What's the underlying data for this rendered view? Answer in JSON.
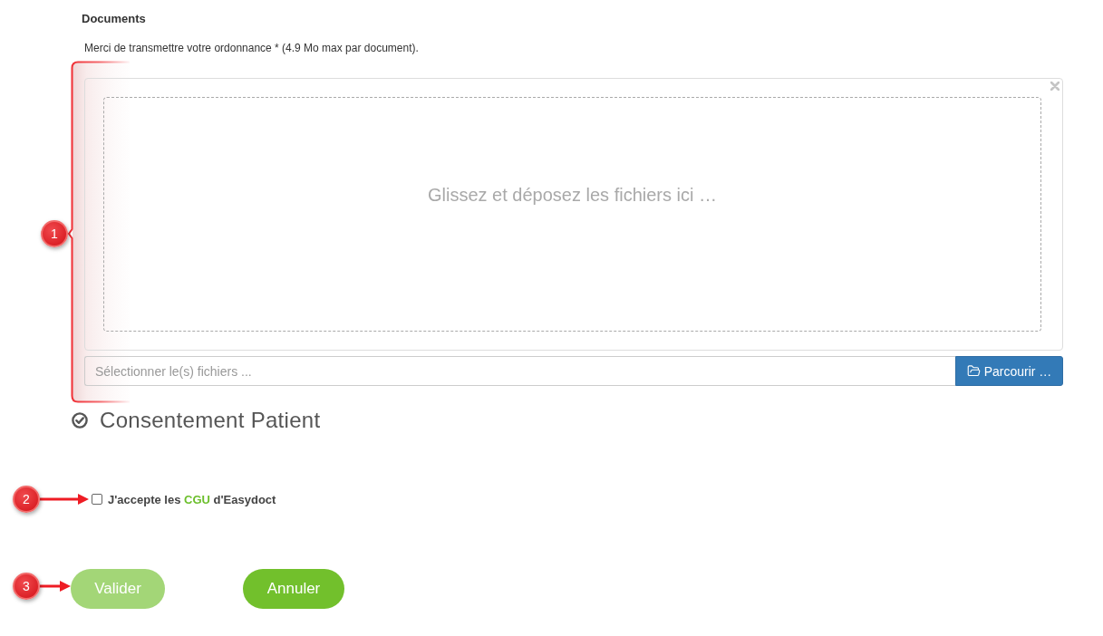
{
  "documents": {
    "title": "Documents",
    "instructions": "Merci de transmettre votre ordonnance * (4.9 Mo max par document)."
  },
  "upload": {
    "annotation": {
      "number": "1"
    },
    "drop_prompt": "Glissez et déposez les fichiers ici …",
    "file_field": {
      "placeholder": "Sélectionner le(s) fichiers ..."
    },
    "browse_button": "Parcourir …"
  },
  "consent": {
    "heading": "Consentement Patient",
    "annotation": {
      "number": "2"
    },
    "checkbox": {
      "checked": false,
      "label_start": "J'accepte les",
      "link": "CGU",
      "label_end": "d'Easydoct"
    }
  },
  "actions": {
    "annotation": {
      "number": "3"
    },
    "buttons": [
      {
        "label": "Valider",
        "disabled": true
      },
      {
        "label": "Annuler",
        "disabled": false
      }
    ]
  }
}
